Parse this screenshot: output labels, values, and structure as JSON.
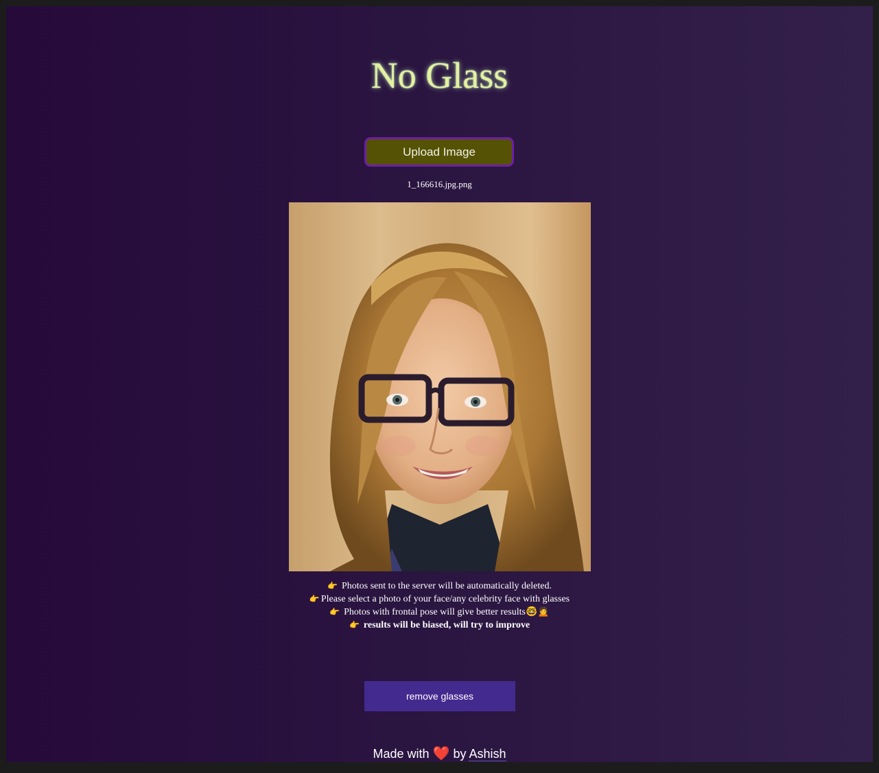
{
  "app": {
    "title": "No Glass"
  },
  "upload": {
    "label": "Upload Image",
    "filename": "1_166616.jpg.png"
  },
  "notes": [
    {
      "icon": "pointing-hand-icon",
      "text": "Photos sent to the server will be automatically deleted."
    },
    {
      "icon": "pointing-hand-icon",
      "text": "Please select a photo of your face/any celebrity face with glasses"
    },
    {
      "icon": "pointing-hand-icon",
      "text": "Photos with frontal pose will give better results🤓🙍"
    },
    {
      "icon": "pointing-hand-icon",
      "text": "results will be biased, will try to improve"
    }
  ],
  "action": {
    "label": "remove glasses"
  },
  "footer": {
    "prefix": "Made with",
    "heart": "❤️",
    "by": "by",
    "author": "Ashish"
  },
  "colors": {
    "upload_bg": "#555205",
    "upload_border": "#6d1fa6",
    "action_bg": "#432a8e",
    "title": "#e6f0a0"
  }
}
